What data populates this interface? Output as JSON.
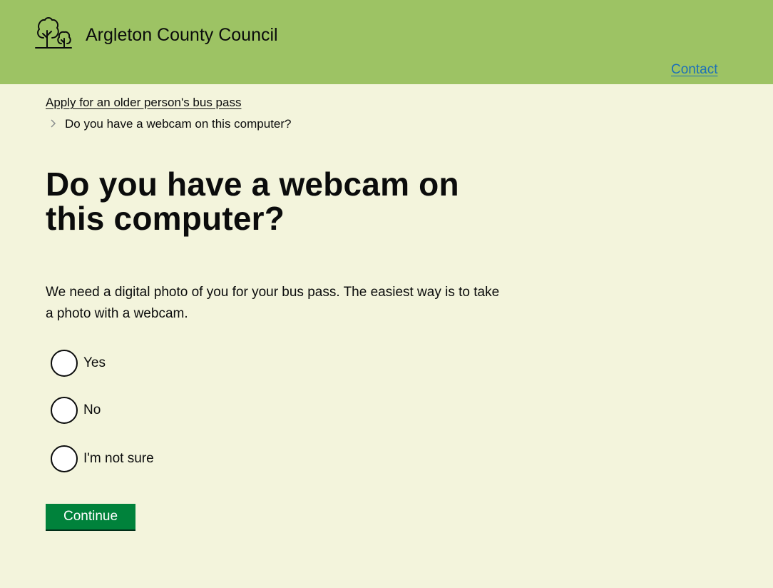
{
  "header": {
    "site_name": "Argleton County Council",
    "logo_icon": "trees-logo-icon",
    "contact_link": "Contact"
  },
  "breadcrumb": {
    "parent_link": "Apply for an older person's bus pass",
    "separator_icon": "chevron-right-icon",
    "current": "Do you have a webcam on this computer?"
  },
  "main": {
    "title": "Do you have a webcam on this computer?",
    "intro": "We need a digital photo of you for your bus pass. The easiest way is to take a photo with a webcam.",
    "options": [
      {
        "label": "Yes",
        "selected": false
      },
      {
        "label": "No",
        "selected": false
      },
      {
        "label": "I'm not sure",
        "selected": false
      }
    ],
    "continue_label": "Continue"
  },
  "colors": {
    "header_bg": "#9dc364",
    "page_bg": "#f3f4dc",
    "link": "#1d70b8",
    "button_bg": "#00823b",
    "text": "#0b0c0c"
  }
}
